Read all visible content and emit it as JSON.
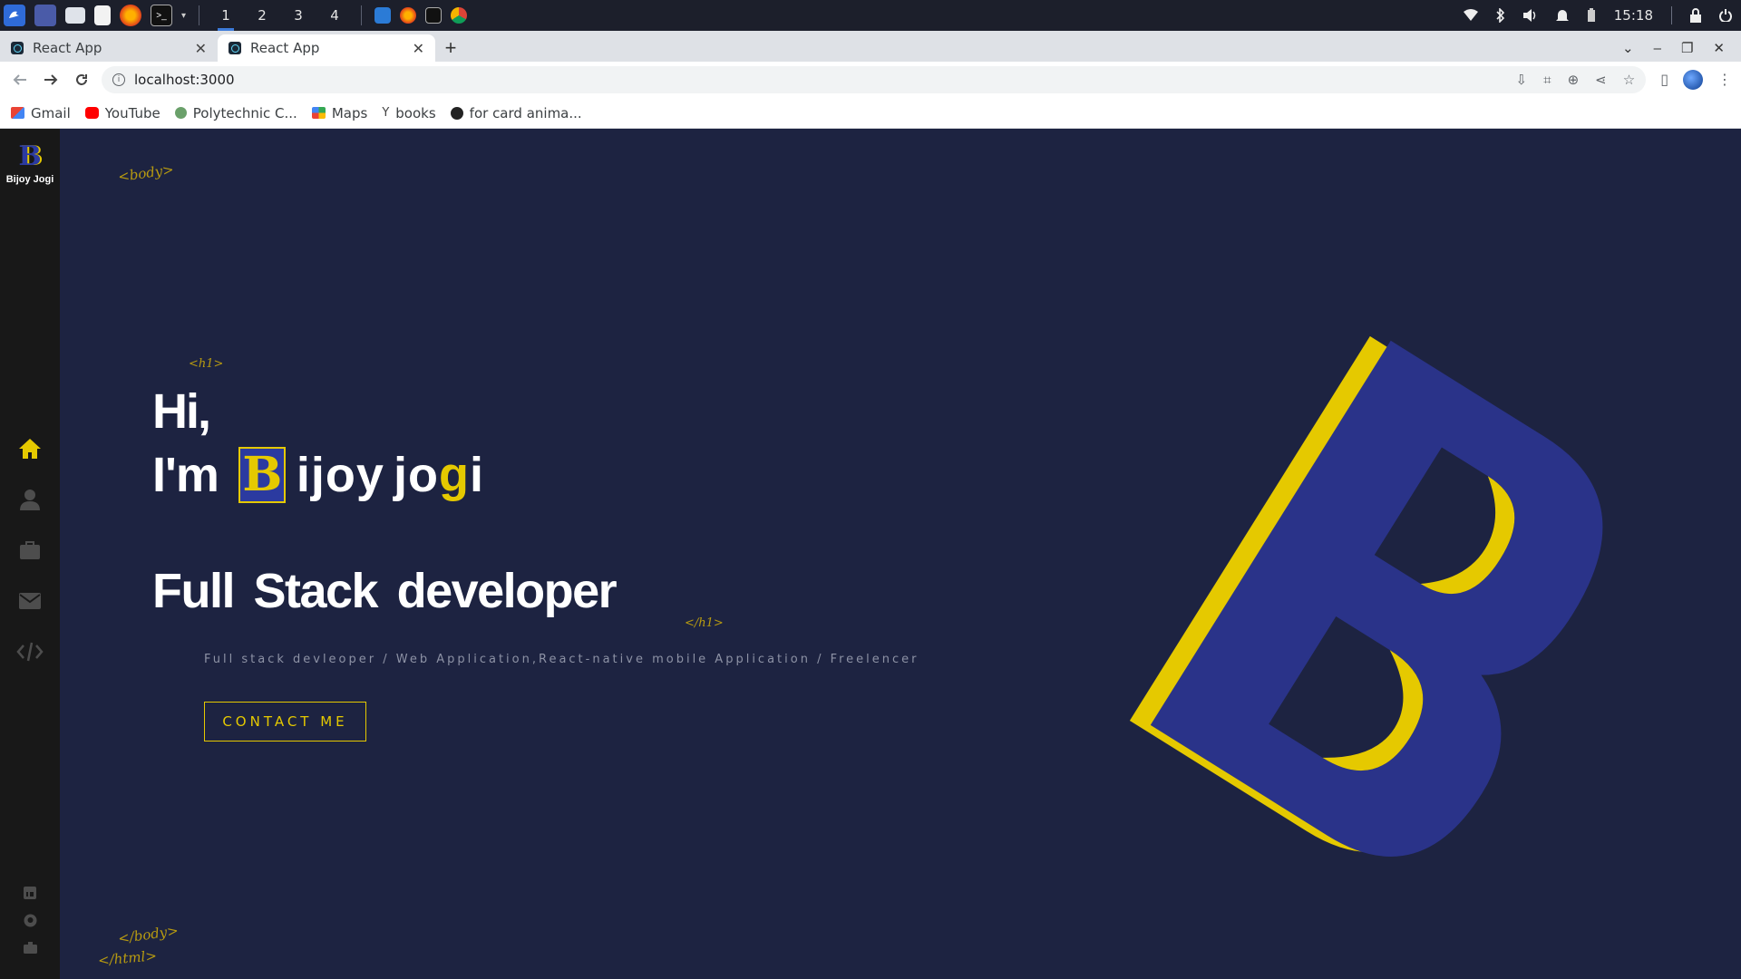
{
  "os": {
    "workspaces": [
      "1",
      "2",
      "3",
      "4"
    ],
    "clock": "15:18"
  },
  "browser": {
    "tabs": [
      {
        "title": "React App"
      },
      {
        "title": "React App"
      }
    ],
    "url": "localhost:3000",
    "bookmarks": [
      {
        "label": "Gmail",
        "icon": "gmail-icon"
      },
      {
        "label": "YouTube",
        "icon": "youtube-icon"
      },
      {
        "label": "Polytechnic C...",
        "icon": "polytechnic-icon"
      },
      {
        "label": "Maps",
        "icon": "maps-icon"
      },
      {
        "label": "books",
        "icon": "books-icon"
      },
      {
        "label": "for card anima...",
        "icon": "codepen-icon"
      }
    ]
  },
  "sidebar": {
    "logo_letter": "B",
    "logo_name": "Bijoy Jogi",
    "nav": [
      "home-icon",
      "user-icon",
      "briefcase-icon",
      "mail-icon",
      "code-icon"
    ],
    "active_nav": "home-icon",
    "social": [
      "linkedin-icon",
      "github-icon",
      "portfolio-icon"
    ]
  },
  "page": {
    "tags": {
      "body_open": "<body>",
      "h1_open": "<h1>",
      "h1_close": "</h1>",
      "body_close": "</body>",
      "html_close": "</html>"
    },
    "hero": {
      "greeting": "Hi,",
      "intro": "I'm",
      "logo_letter": "B",
      "name_letters": [
        "i",
        "j",
        "o",
        "y",
        " ",
        "j",
        "o",
        "g",
        "i"
      ],
      "highlighted_letter_index": 7,
      "role": "Full Stack developer",
      "subtitle": "Full stack devleoper / Web Application,React-native mobile Application / Freelencer",
      "cta_label": "CONTACT ME"
    },
    "colors": {
      "accent": "#e5c900",
      "background": "#1d2341",
      "logo_blue": "#2b3aa0",
      "sidebar": "#181818"
    }
  }
}
